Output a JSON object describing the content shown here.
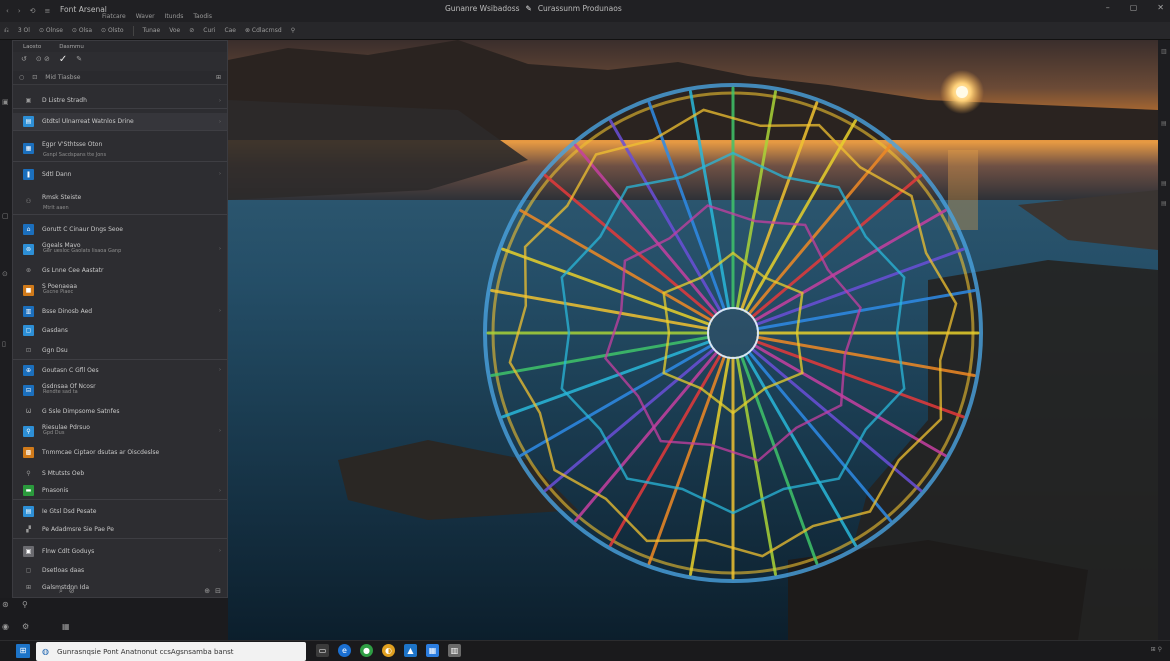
{
  "titlebar": {
    "app_name": "Font Arsenal",
    "menu": [
      "Fiatcare",
      "Waver",
      "Itunds",
      "Taodis"
    ],
    "doc_title_left": "Gunanre Wsibadoss",
    "doc_title_right": "Curassunm Produnaos",
    "window_controls": [
      "minimize-icon",
      "maximize-icon",
      "close-icon"
    ]
  },
  "toolbar": {
    "items": [
      "⎌",
      "3 Ol",
      "⊙ Olnse",
      "⊙ Olsa",
      "⊙ Olsto",
      "Tunae",
      "Voe",
      "⊘",
      "Curi",
      "Cae",
      "⊗ Cdlacrnsd",
      "⚲"
    ]
  },
  "panel": {
    "tabs": [
      "Laosto",
      "Dasmmu"
    ],
    "tools": [
      "↺",
      "⊙ ⊘",
      "✓",
      "✎"
    ],
    "header_label": "Mid Tiasbse",
    "layers": [
      {
        "name": "D Listre Stradh",
        "sub": "",
        "thumb": "plain",
        "icon": "▣"
      },
      {
        "name": "Gtdtsl Ulnarreat Watnlos Drine",
        "sub": "",
        "thumb": "lblue",
        "icon": "▤"
      },
      {
        "name": "Egpr V'Sthtsse Oton",
        "sub": "Gsnpl Sacdspans tte Jons",
        "thumb": "blue",
        "icon": "▦"
      },
      {
        "name": "Sdtl Dann",
        "sub": "",
        "thumb": "blue",
        "icon": "❚"
      },
      {
        "name": "Rmsk Steiste",
        "sub": "Mtrlt aaen",
        "thumb": "plain",
        "icon": "⚇"
      },
      {
        "name": "Gorutt C Cinaur Dngs Seoe",
        "sub": "",
        "thumb": "blue",
        "icon": "⌂"
      },
      {
        "name": "Ggeals Mavo",
        "sub": "Ger uesloc Gaolats lisaoa Ganp",
        "thumb": "lblue",
        "icon": "⊚"
      },
      {
        "name": "Gs Lnne Cee Aastatr",
        "sub": "",
        "thumb": "plain",
        "icon": "⊛"
      },
      {
        "name": "S Poenaeaa",
        "sub": "Gscne Piaec",
        "thumb": "orange",
        "icon": "■"
      },
      {
        "name": "Bsse Dinosb Aed",
        "sub": "",
        "thumb": "blue",
        "icon": "▥"
      },
      {
        "name": "Gasdans",
        "sub": "",
        "thumb": "lblue",
        "icon": "▢"
      },
      {
        "name": "Ggn Dsu",
        "sub": "",
        "thumb": "plain",
        "icon": "⊡"
      },
      {
        "name": "Goutasn C Gfll Oes",
        "sub": "",
        "thumb": "blue",
        "icon": "⊕"
      },
      {
        "name": "Gsdnsaa Of Ncosr",
        "sub": "Rendte sad ta",
        "thumb": "blue",
        "icon": "⊟"
      },
      {
        "name": "G Ssle Dimpsome Satnfes",
        "sub": "",
        "thumb": "plain",
        "icon": "Ѡ"
      },
      {
        "name": "Riesulae Pdrsuo",
        "sub": "Gpd Dus",
        "thumb": "lblue",
        "icon": "⚲"
      },
      {
        "name": "Tnmmcae Ciptaor dsutas ar Oiscdeslse",
        "sub": "",
        "thumb": "orange",
        "icon": "▩"
      },
      {
        "name": "S Mtutsts Oeb",
        "sub": "",
        "thumb": "plain",
        "icon": "⚲"
      },
      {
        "name": "Pnasonis",
        "sub": "",
        "thumb": "green",
        "icon": "▬"
      },
      {
        "name": "Ie Gtsl Dsd Pesate",
        "sub": "",
        "thumb": "lblue",
        "icon": "▤"
      },
      {
        "name": "Pe Adadmsre Sie Pae Pe",
        "sub": "",
        "thumb": "plain",
        "icon": "▞"
      },
      {
        "name": "Flnw Cdlt Goduys",
        "sub": "",
        "thumb": "gray",
        "icon": "▣"
      },
      {
        "name": "Dsetloas daas",
        "sub": "",
        "thumb": "plain",
        "icon": "▢"
      },
      {
        "name": "Galsmstdnn Ida",
        "sub": "",
        "thumb": "plain",
        "icon": "⊞"
      }
    ],
    "footer": [
      "⌕",
      "⊘"
    ]
  },
  "taskbar": {
    "search_text": "Gunrasnqsie Pont Anatnonut ccsAgsnsamba banst",
    "right_text": "⊞ ⚲"
  },
  "colors": {
    "accent": "#1b6fbd",
    "panel_bg": "#2d2d31",
    "titlebar_bg": "#202023"
  }
}
